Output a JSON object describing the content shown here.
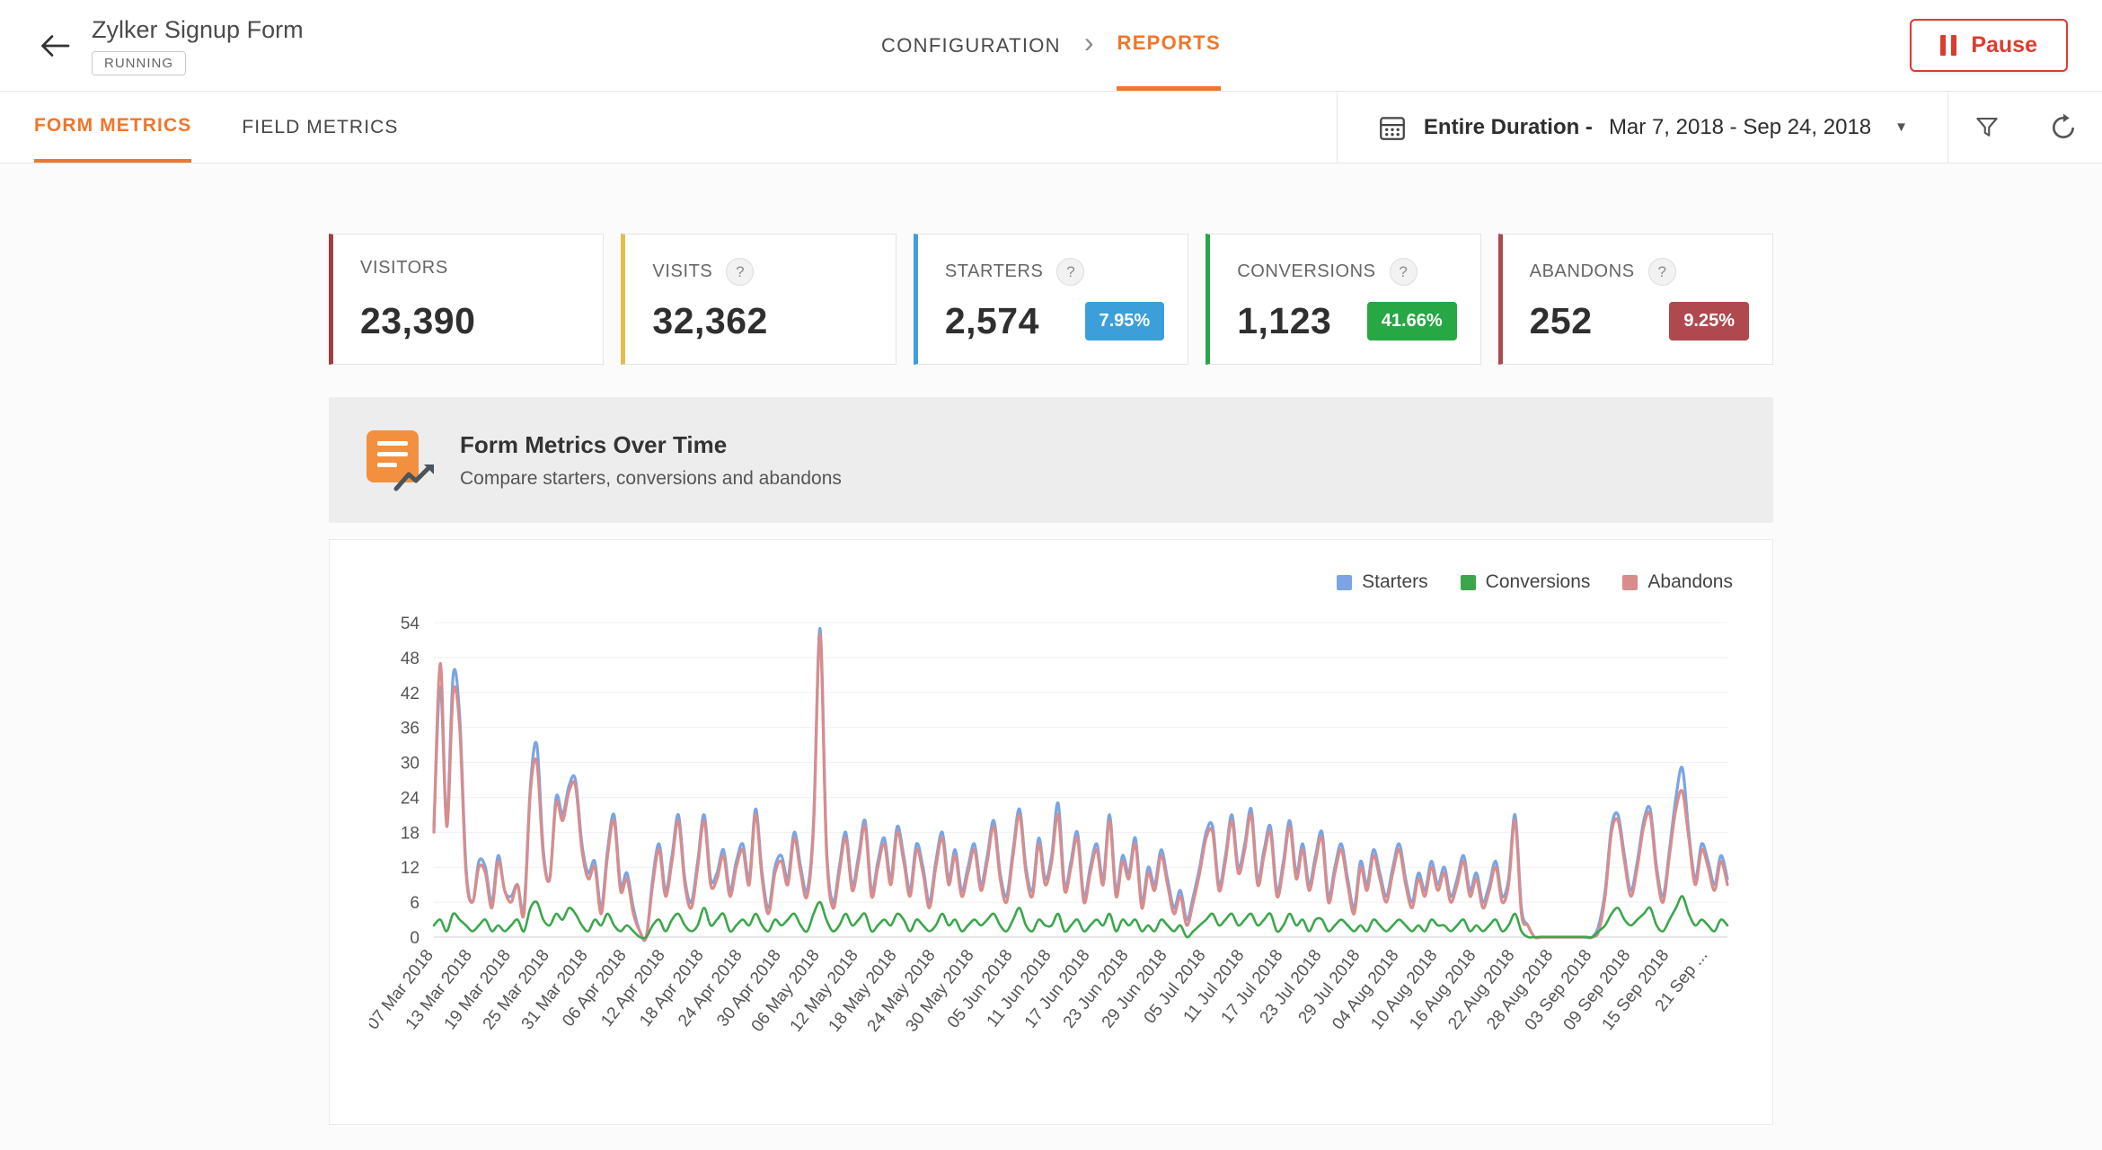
{
  "header": {
    "title": "Zylker Signup Form",
    "status": "RUNNING",
    "breadcrumb": {
      "configuration": "CONFIGURATION",
      "separator": "›",
      "reports": "REPORTS"
    },
    "pause_label": "Pause"
  },
  "toolbar": {
    "tabs": [
      {
        "label": "FORM METRICS",
        "active": true
      },
      {
        "label": "FIELD METRICS",
        "active": false
      }
    ],
    "date_range": {
      "label_bold": "Entire Duration -",
      "label_range": "Mar 7, 2018 - Sep 24, 2018",
      "caret": "▼"
    }
  },
  "cards": [
    {
      "label": "VISITORS",
      "value": "23,390",
      "help": "",
      "badge": "",
      "accent": "#A03E44",
      "badge_color": ""
    },
    {
      "label": "VISITS",
      "value": "32,362",
      "help": "?",
      "badge": "",
      "accent": "#E2BE4A",
      "badge_color": ""
    },
    {
      "label": "STARTERS",
      "value": "2,574",
      "help": "?",
      "badge": "7.95%",
      "accent": "#3D9FD9",
      "badge_color": "#3D9FD9"
    },
    {
      "label": "CONVERSIONS",
      "value": "1,123",
      "help": "?",
      "badge": "41.66%",
      "accent": "#28A745",
      "badge_color": "#28A745"
    },
    {
      "label": "ABANDONS",
      "value": "252",
      "help": "?",
      "badge": "9.25%",
      "accent": "#B0494F",
      "badge_color": "#B0494F"
    }
  ],
  "section_header": {
    "title": "Form Metrics Over Time",
    "subtitle": "Compare starters, conversions and abandons"
  },
  "chart_data": {
    "type": "line",
    "title": "Form Metrics Over Time",
    "x_start": "07 Mar 2018",
    "x_end": "24 Sep 2018",
    "tick_interval_days": 6,
    "tick_labels": [
      "07 Mar 2018",
      "13 Mar 2018",
      "19 Mar 2018",
      "25 Mar 2018",
      "31 Mar 2018",
      "06 Apr 2018",
      "12 Apr 2018",
      "18 Apr 2018",
      "24 Apr 2018",
      "30 Apr 2018",
      "06 May 2018",
      "12 May 2018",
      "18 May 2018",
      "24 May 2018",
      "30 May 2018",
      "05 Jun 2018",
      "11 Jun 2018",
      "17 Jun 2018",
      "23 Jun 2018",
      "29 Jun 2018",
      "05 Jul 2018",
      "11 Jul 2018",
      "17 Jul 2018",
      "23 Jul 2018",
      "29 Jul 2018",
      "04 Aug 2018",
      "10 Aug 2018",
      "16 Aug 2018",
      "22 Aug 2018",
      "28 Aug 2018",
      "03 Sep 2018",
      "09 Sep 2018",
      "15 Sep 2018",
      "21 Sep ..."
    ],
    "ylim": [
      0,
      54
    ],
    "yticks": [
      0,
      6,
      12,
      18,
      24,
      30,
      36,
      42,
      48,
      54
    ],
    "grid": true,
    "legend_position": "top-right",
    "series": [
      {
        "name": "Starters",
        "color": "#7AA4E3",
        "values": [
          19,
          43,
          20,
          45,
          38,
          12,
          6,
          13,
          12,
          6,
          14,
          8,
          7,
          9,
          5,
          26,
          33,
          15,
          10,
          24,
          21,
          26,
          27,
          16,
          11,
          13,
          5,
          15,
          21,
          9,
          11,
          5,
          1,
          0,
          10,
          16,
          8,
          14,
          21,
          10,
          6,
          13,
          21,
          10,
          11,
          15,
          8,
          13,
          16,
          10,
          22,
          11,
          5,
          12,
          14,
          10,
          18,
          12,
          8,
          20,
          53,
          16,
          6,
          12,
          18,
          9,
          14,
          20,
          8,
          13,
          17,
          10,
          19,
          14,
          8,
          16,
          12,
          6,
          13,
          18,
          10,
          15,
          8,
          12,
          16,
          9,
          14,
          20,
          11,
          7,
          15,
          22,
          12,
          8,
          17,
          10,
          14,
          23,
          9,
          13,
          18,
          7,
          12,
          16,
          10,
          21,
          8,
          14,
          11,
          17,
          6,
          12,
          9,
          15,
          10,
          5,
          8,
          3,
          7,
          12,
          18,
          19,
          9,
          14,
          21,
          12,
          16,
          22,
          10,
          15,
          19,
          8,
          13,
          20,
          11,
          16,
          9,
          14,
          18,
          7,
          12,
          16,
          10,
          5,
          13,
          9,
          15,
          11,
          7,
          12,
          16,
          10,
          6,
          11,
          8,
          13,
          9,
          12,
          7,
          10,
          14,
          8,
          11,
          6,
          9,
          13,
          7,
          10,
          21,
          5,
          2,
          0,
          0,
          0,
          0,
          0,
          0,
          0,
          0,
          0,
          0,
          2,
          8,
          19,
          21,
          14,
          8,
          13,
          20,
          22,
          12,
          7,
          15,
          24,
          29,
          18,
          10,
          16,
          13,
          9,
          14,
          10
        ]
      },
      {
        "name": "Conversions",
        "color": "#3BA64C",
        "values": [
          2,
          3,
          1,
          4,
          3,
          2,
          1,
          2,
          3,
          1,
          2,
          1,
          2,
          3,
          1,
          5,
          6,
          3,
          2,
          4,
          3,
          5,
          4,
          2,
          1,
          3,
          2,
          4,
          2,
          1,
          2,
          1,
          0,
          0,
          2,
          3,
          1,
          3,
          4,
          2,
          1,
          2,
          5,
          2,
          3,
          4,
          1,
          2,
          3,
          2,
          4,
          2,
          1,
          3,
          2,
          3,
          4,
          2,
          1,
          4,
          6,
          3,
          1,
          2,
          4,
          2,
          3,
          4,
          1,
          2,
          3,
          2,
          4,
          3,
          1,
          3,
          2,
          1,
          2,
          4,
          2,
          3,
          1,
          2,
          3,
          2,
          3,
          4,
          2,
          1,
          3,
          5,
          2,
          1,
          3,
          2,
          2,
          4,
          1,
          2,
          3,
          1,
          2,
          3,
          2,
          4,
          1,
          3,
          2,
          3,
          1,
          2,
          1,
          3,
          2,
          1,
          2,
          0,
          1,
          2,
          3,
          4,
          2,
          3,
          4,
          2,
          3,
          4,
          2,
          3,
          4,
          1,
          2,
          4,
          2,
          3,
          1,
          3,
          3,
          1,
          2,
          3,
          2,
          1,
          2,
          1,
          3,
          2,
          1,
          2,
          3,
          2,
          1,
          2,
          1,
          3,
          2,
          2,
          1,
          2,
          3,
          1,
          2,
          1,
          2,
          3,
          1,
          2,
          4,
          1,
          0,
          0,
          0,
          0,
          0,
          0,
          0,
          0,
          0,
          0,
          0,
          1,
          2,
          4,
          5,
          3,
          2,
          3,
          4,
          5,
          2,
          1,
          3,
          5,
          7,
          4,
          2,
          3,
          2,
          1,
          3,
          2
        ]
      },
      {
        "name": "Abandons",
        "color": "#D98C8C",
        "values": [
          18,
          47,
          19,
          42,
          36,
          11,
          6,
          12,
          11,
          5,
          13,
          8,
          6,
          9,
          4,
          25,
          30,
          14,
          10,
          23,
          20,
          25,
          26,
          15,
          10,
          12,
          4,
          14,
          20,
          8,
          10,
          4,
          1,
          0,
          9,
          15,
          7,
          13,
          20,
          9,
          5,
          12,
          20,
          9,
          10,
          14,
          7,
          12,
          15,
          9,
          21,
          10,
          4,
          11,
          13,
          9,
          17,
          11,
          7,
          19,
          52,
          15,
          5,
          11,
          17,
          8,
          13,
          19,
          7,
          12,
          16,
          9,
          18,
          13,
          7,
          15,
          11,
          5,
          12,
          17,
          9,
          14,
          7,
          11,
          15,
          8,
          13,
          19,
          10,
          6,
          14,
          21,
          11,
          7,
          16,
          9,
          13,
          21,
          8,
          12,
          17,
          6,
          11,
          15,
          9,
          20,
          7,
          13,
          10,
          16,
          5,
          11,
          8,
          14,
          9,
          4,
          7,
          2,
          6,
          11,
          17,
          18,
          8,
          13,
          20,
          11,
          15,
          21,
          9,
          14,
          18,
          7,
          12,
          19,
          10,
          15,
          8,
          13,
          17,
          6,
          11,
          15,
          9,
          4,
          12,
          8,
          14,
          10,
          6,
          11,
          15,
          9,
          5,
          10,
          7,
          12,
          8,
          11,
          6,
          9,
          13,
          7,
          10,
          5,
          8,
          12,
          6,
          9,
          20,
          4,
          2,
          0,
          0,
          0,
          0,
          0,
          0,
          0,
          0,
          0,
          0,
          1,
          7,
          18,
          20,
          13,
          7,
          12,
          19,
          21,
          11,
          6,
          14,
          22,
          25,
          17,
          9,
          15,
          12,
          8,
          13,
          9
        ]
      }
    ]
  }
}
